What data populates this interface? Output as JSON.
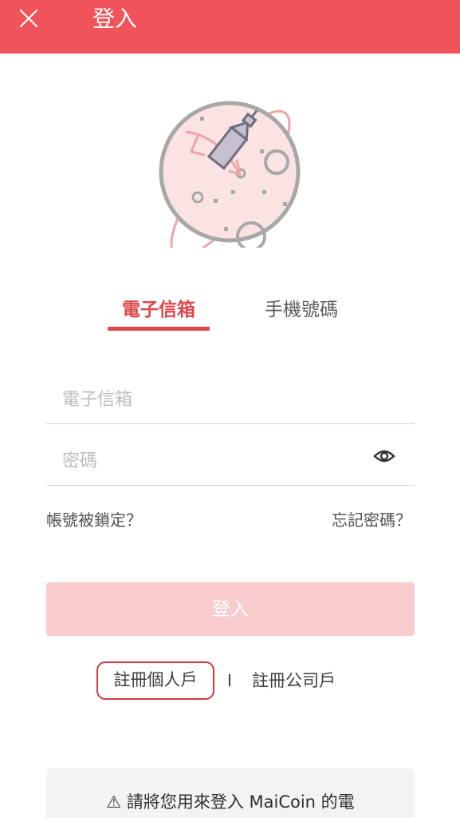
{
  "header": {
    "title": "登入"
  },
  "tabs": [
    {
      "label": "電子信箱",
      "active": true
    },
    {
      "label": "手機號碼",
      "active": false
    }
  ],
  "form": {
    "email": {
      "placeholder": "電子信箱",
      "value": ""
    },
    "password": {
      "placeholder": "密碼",
      "value": ""
    }
  },
  "links": {
    "account_locked": "帳號被鎖定？",
    "forgot_password": "忘記密碼？"
  },
  "login_button": {
    "label": "登入"
  },
  "register": {
    "personal": "註冊個人戶",
    "separator": "I",
    "company": "註冊公司戶"
  },
  "notice": {
    "text": "⚠ 請將您用來登入 MaiCoin 的電"
  },
  "colors": {
    "brand": "#f0545a",
    "active_tab": "#e0474d",
    "button_disabled": "#f9cccd",
    "highlight_border": "#d03c44"
  },
  "icons": {
    "close": "close-icon",
    "password_toggle": "eye-icon",
    "illustration": "rocket-planet-illustration"
  }
}
